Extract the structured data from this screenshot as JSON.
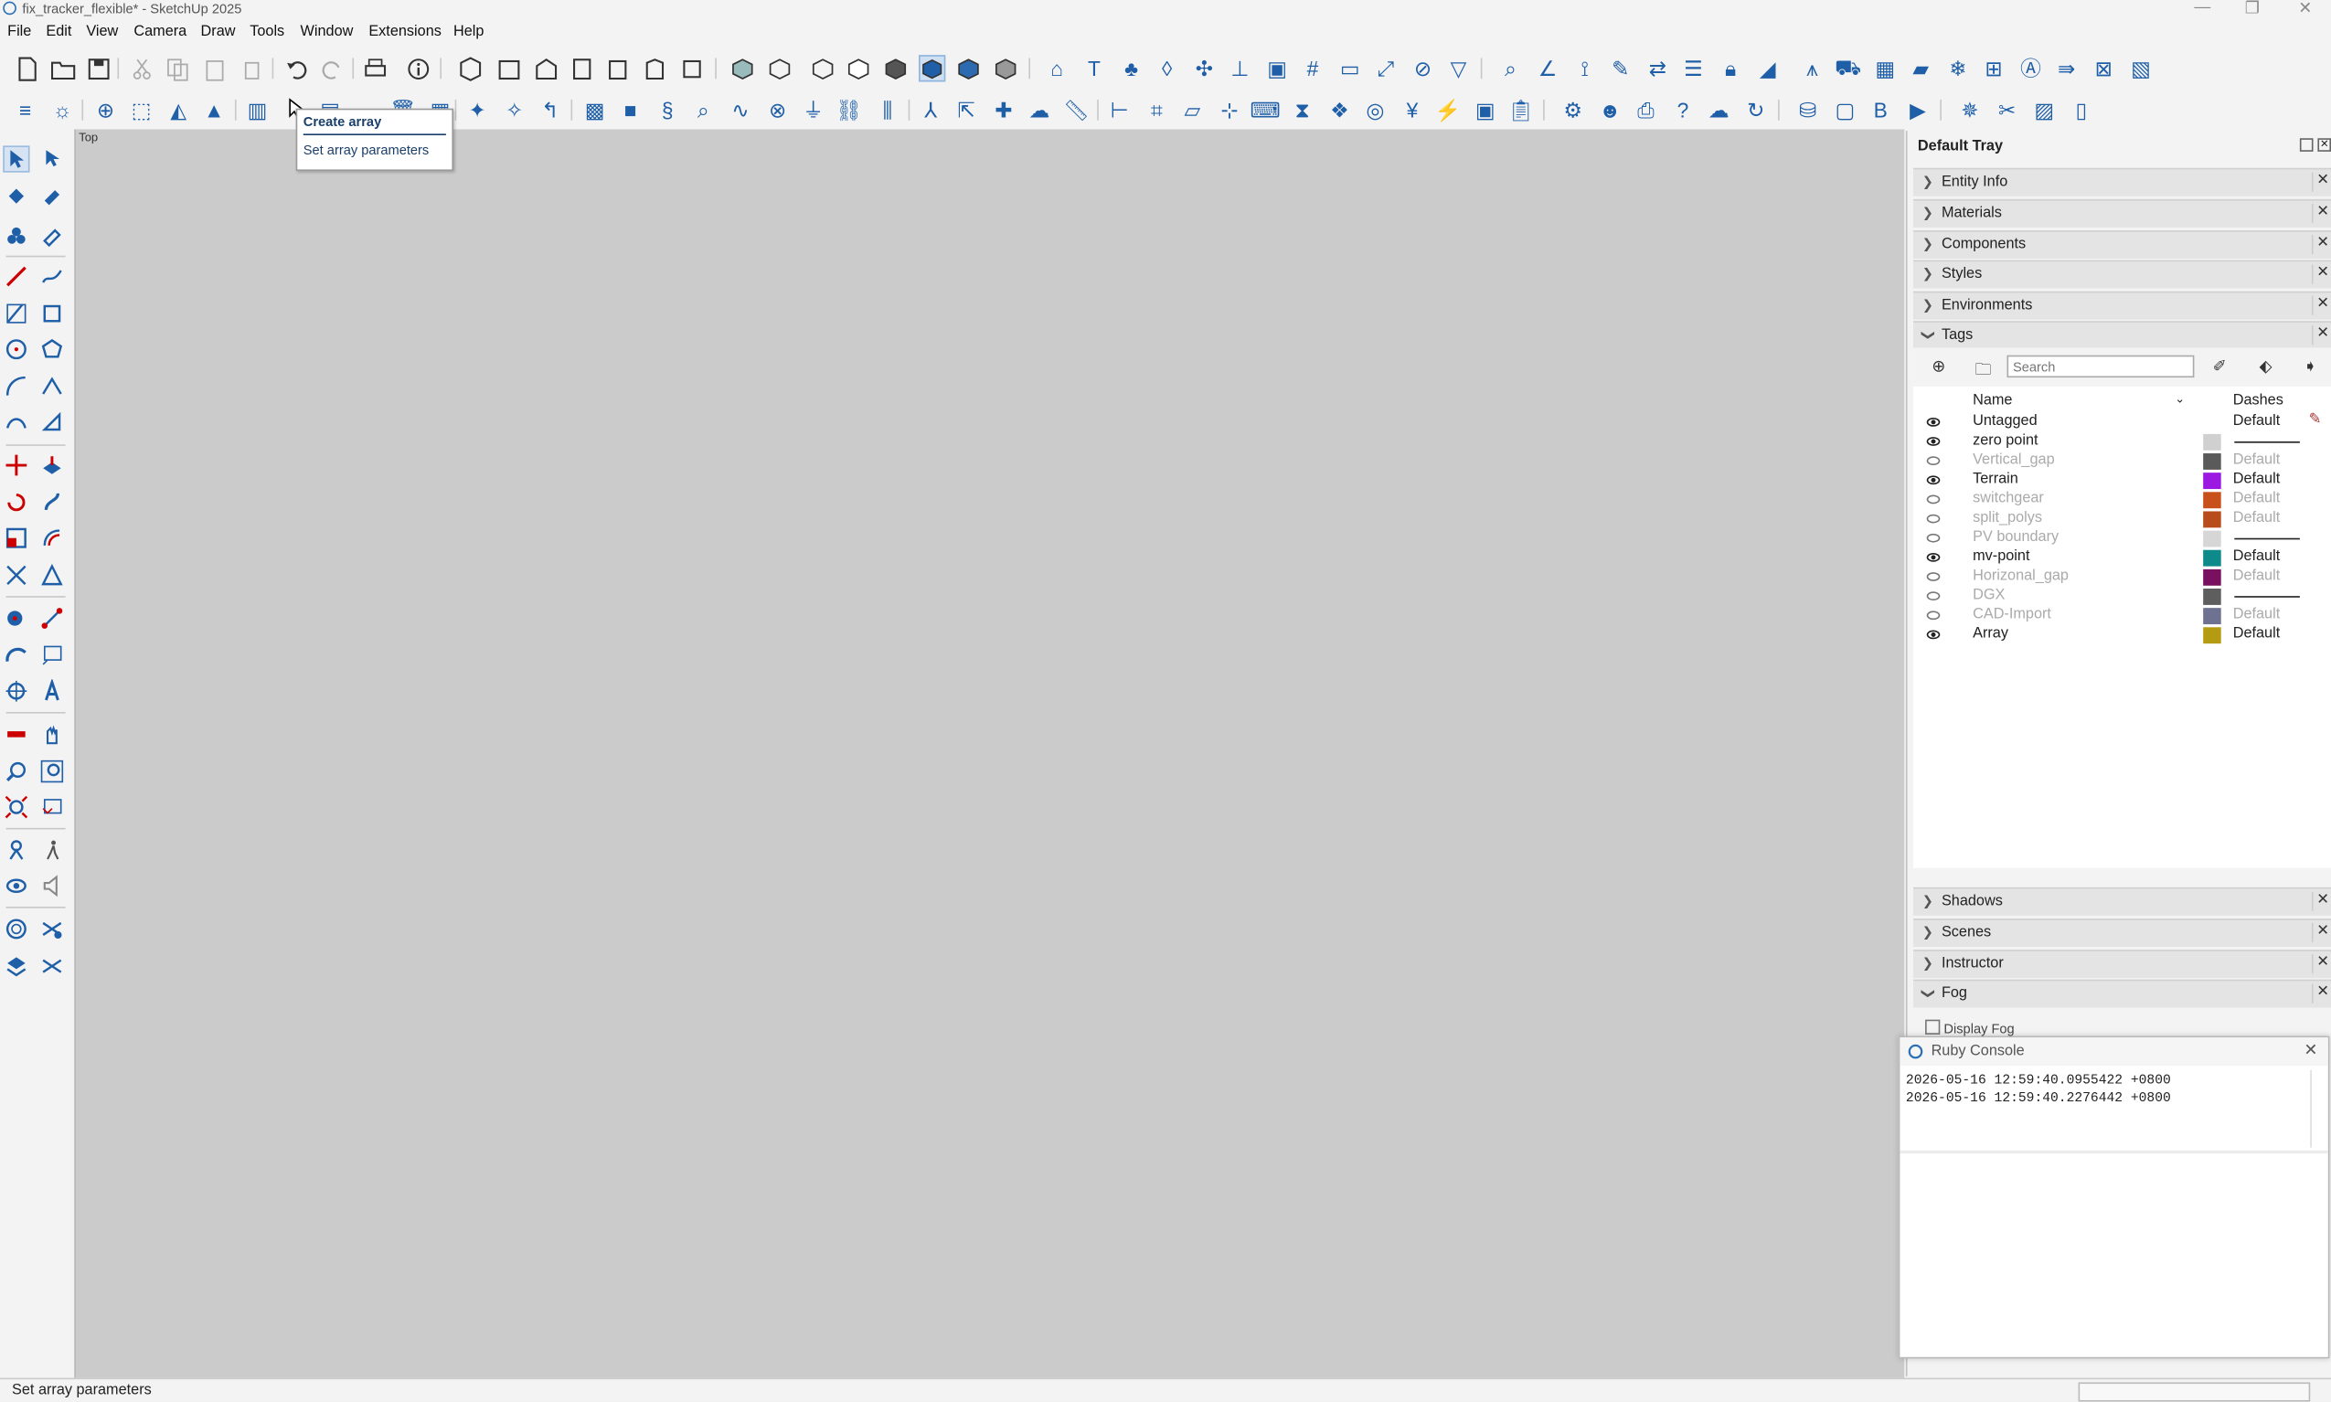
{
  "window": {
    "title": "fix_tracker_flexible* - SketchUp 2025",
    "controls": [
      "—",
      "❐",
      "✕"
    ]
  },
  "menu": [
    "File",
    "Edit",
    "View",
    "Camera",
    "Draw",
    "Tools",
    "Window",
    "Extensions",
    "Help"
  ],
  "viewport": {
    "label": "Top"
  },
  "tooltip": {
    "title": "Create array",
    "description": "Set array parameters"
  },
  "tray": {
    "title": "Default Tray",
    "panels_top": [
      "Entity Info",
      "Materials",
      "Components",
      "Styles",
      "Environments",
      "Tags"
    ],
    "panels_bottom": [
      "Shadows",
      "Scenes",
      "Instructor",
      "Fog"
    ],
    "fog_option": "Display Fog"
  },
  "tags": {
    "search_placeholder": "Search",
    "col_name": "Name",
    "col_dashes": "Dashes",
    "rows": [
      {
        "name": "Untagged",
        "visible": true,
        "color": "",
        "dashes": "Default"
      },
      {
        "name": "zero point",
        "visible": true,
        "color": "#d0d0d0",
        "dashes": ""
      },
      {
        "name": "Vertical_gap",
        "visible": false,
        "color": "#5a5a5a",
        "dashes": "Default"
      },
      {
        "name": "Terrain",
        "visible": true,
        "color": "#9b19e0",
        "dashes": "Default"
      },
      {
        "name": "switchgear",
        "visible": false,
        "color": "#c8501a",
        "dashes": "Default"
      },
      {
        "name": "split_polys",
        "visible": false,
        "color": "#b84c1a",
        "dashes": "Default"
      },
      {
        "name": "PV boundary",
        "visible": false,
        "color": "#d6d6d6",
        "dashes": ""
      },
      {
        "name": "mv-point",
        "visible": true,
        "color": "#0f8a8a",
        "dashes": "Default"
      },
      {
        "name": "Horizonal_gap",
        "visible": false,
        "color": "#7a1060",
        "dashes": "Default"
      },
      {
        "name": "DGX",
        "visible": false,
        "color": "#5e5e5e",
        "dashes": ""
      },
      {
        "name": "CAD-Import",
        "visible": false,
        "color": "#6e7190",
        "dashes": "Default"
      },
      {
        "name": "Array",
        "visible": true,
        "color": "#b59b12",
        "dashes": "Default"
      }
    ]
  },
  "ruby_console": {
    "title": "Ruby Console",
    "lines": [
      "2026-05-16 12:59:40.0955422 +0800",
      "2026-05-16 12:59:40.2276442 +0800"
    ]
  },
  "status": {
    "text": "Set array parameters"
  },
  "colors": {
    "accent": "#1f5fa8",
    "viewport": "#cbcbcb"
  }
}
